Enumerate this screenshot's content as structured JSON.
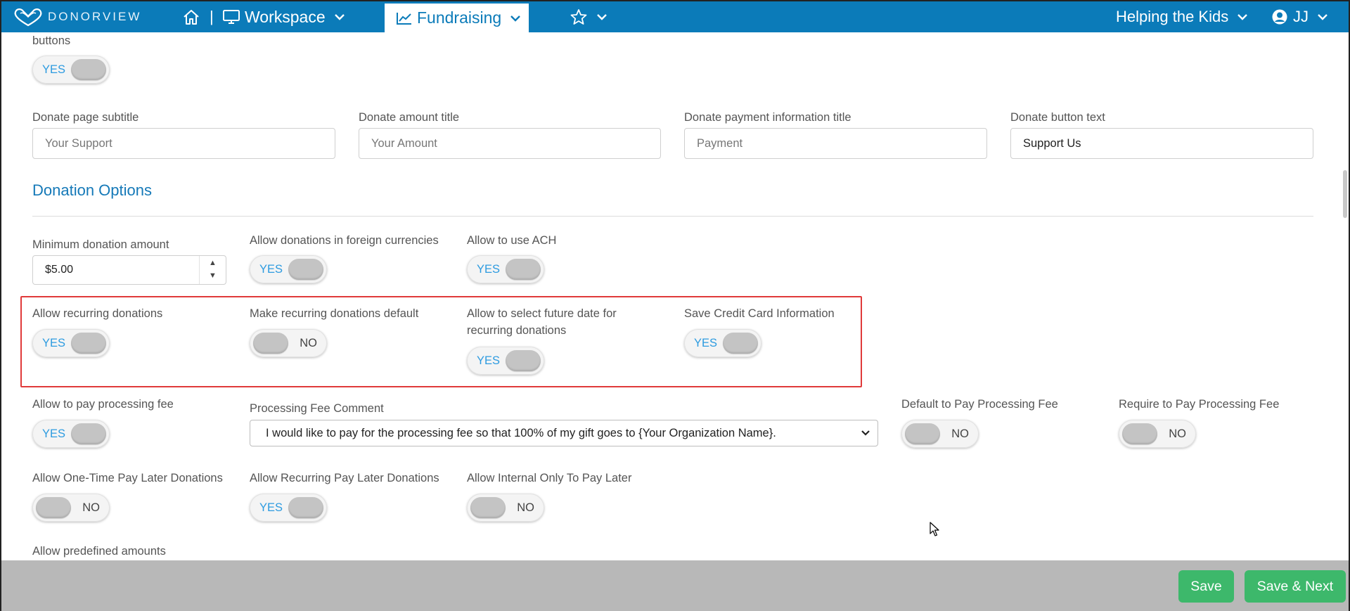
{
  "nav": {
    "brand": "DONORVIEW",
    "workspace_label": "Workspace",
    "fundraising_label": "Fundraising",
    "organization_label": "Helping the Kids",
    "user_initials": "JJ",
    "separator": "|"
  },
  "top_partial": {
    "label": "buttons",
    "toggle_text": "YES"
  },
  "donate_fields": [
    {
      "label": "Donate page subtitle",
      "value": "Your Support"
    },
    {
      "label": "Donate amount title",
      "value": "Your Amount"
    },
    {
      "label": "Donate payment information title",
      "value": "Payment"
    },
    {
      "label": "Donate button text",
      "value": "Support Us"
    }
  ],
  "section": {
    "title": "Donation Options"
  },
  "min_donation": {
    "label": "Minimum donation amount",
    "value": "$5.00"
  },
  "toggles": {
    "foreign_currency": {
      "label": "Allow donations in foreign currencies",
      "text": "YES"
    },
    "ach": {
      "label": "Allow to use ACH",
      "text": "YES"
    },
    "recurring": {
      "label": "Allow recurring donations",
      "text": "YES"
    },
    "recurring_default": {
      "label": "Make recurring donations default",
      "text": "NO"
    },
    "future_date": {
      "label": "Allow to select future date for recurring donations",
      "text": "YES"
    },
    "save_card": {
      "label": "Save Credit Card Information",
      "text": "YES"
    },
    "pay_fee": {
      "label": "Allow to pay processing fee",
      "text": "YES"
    },
    "default_fee": {
      "label": "Default to Pay Processing Fee",
      "text": "NO"
    },
    "require_fee": {
      "label": "Require to Pay Processing Fee",
      "text": "NO"
    },
    "onetime_later": {
      "label": "Allow One-Time Pay Later Donations",
      "text": "NO"
    },
    "recurring_later": {
      "label": "Allow Recurring Pay Later Donations",
      "text": "YES"
    },
    "internal_later": {
      "label": "Allow Internal Only To Pay Later",
      "text": "NO"
    }
  },
  "processing_fee_comment": {
    "label": "Processing Fee Comment",
    "selected": "I would like to pay for the processing fee so that 100% of my gift goes to {Your Organization Name}."
  },
  "predefined": {
    "label": "Allow predefined amounts"
  },
  "footer": {
    "save": "Save",
    "save_next": "Save & Next"
  },
  "colors": {
    "nav_bg": "#0b7bb9",
    "accent": "#1579b8",
    "toggle_yes": "#2d9be0",
    "save_button": "#3db86b",
    "highlight": "#e03a3a"
  }
}
